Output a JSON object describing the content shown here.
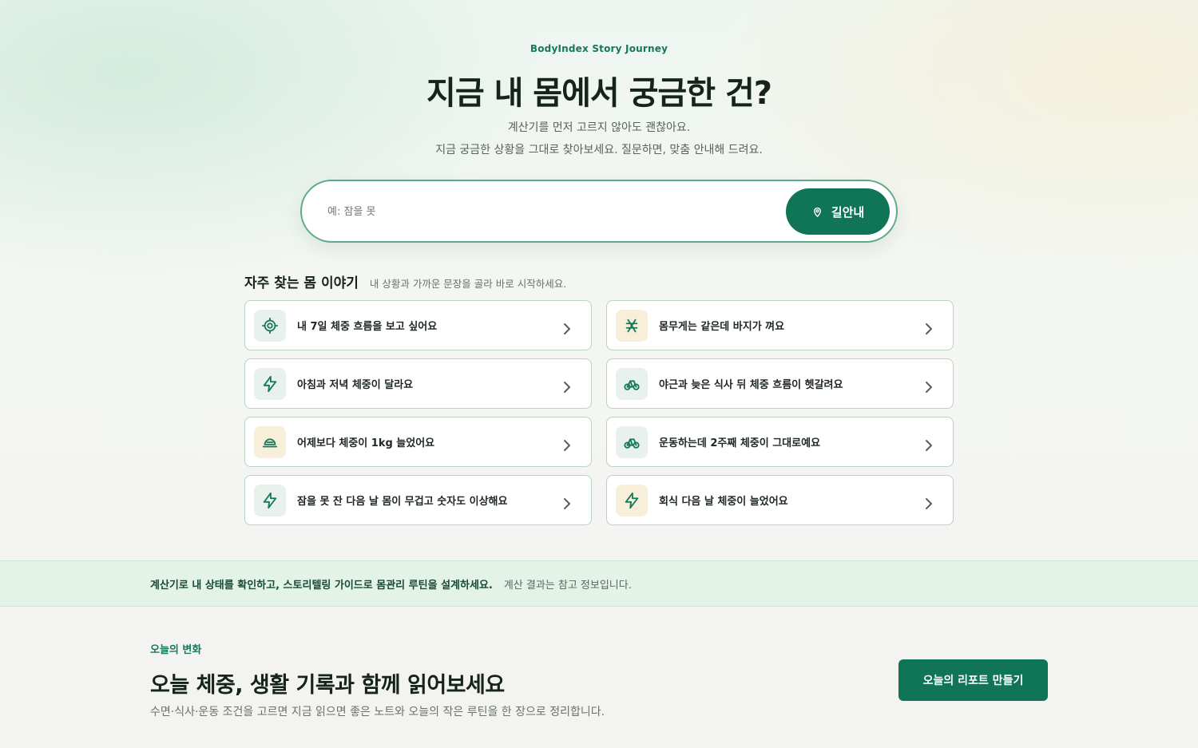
{
  "hero": {
    "eyebrow": "BodyIndex Story Journey",
    "title": "지금 내 몸에서 궁금한 건?",
    "subtitle_line1": "계산기를 먼저 고르지 않아도 괜찮아요.",
    "subtitle_line2": "지금 궁금한 상황을 그대로 찾아보세요. 질문하면, 맞춤 안내해 드려요."
  },
  "search": {
    "placeholder": "예: 잠을 못",
    "button_label": "길안내",
    "button_icon": "map-pin-icon"
  },
  "stories": {
    "title": "자주 찾는 몸 이야기",
    "description": "내 상황과 가까운 문장을 골라 바로 시작하세요.",
    "items": [
      {
        "label": "내 7일 체중 흐름을 보고 싶어요",
        "icon": "target-icon",
        "tone": "green"
      },
      {
        "label": "몸무게는 같은데 바지가 껴요",
        "icon": "scale-icon",
        "tone": "beige"
      },
      {
        "label": "아침과 저녁 체중이 달라요",
        "icon": "lightning-icon",
        "tone": "green"
      },
      {
        "label": "야근과 늦은 식사 뒤 체중 흐름이 헷갈려요",
        "icon": "bicycle-icon",
        "tone": "green"
      },
      {
        "label": "어제보다 체중이 1kg 늘었어요",
        "icon": "meal-cover-icon",
        "tone": "beige"
      },
      {
        "label": "운동하는데 2주째 체중이 그대로예요",
        "icon": "bicycle-icon",
        "tone": "green"
      },
      {
        "label": "잠을 못 잔 다음 날 몸이 무겁고 숫자도 이상해요",
        "icon": "lightning-icon",
        "tone": "green"
      },
      {
        "label": "회식 다음 날 체중이 늘었어요",
        "icon": "lightning-icon",
        "tone": "beige"
      }
    ]
  },
  "banner": {
    "strong": "계산기로 내 상태를 확인하고, 스토리텔링 가이드로 몸관리 루틴을 설계하세요.",
    "note": "계산 결과는 참고 정보입니다."
  },
  "today": {
    "eyebrow": "오늘의 변화",
    "title": "오늘 체중, 생활 기록과 함께 읽어보세요",
    "description": "수면·식사·운동 조건을 고르면 지금 읽으면 좋은 노트와 오늘의 작은 루틴을 한 장으로 정리합니다.",
    "button_label": "오늘의 리포트 만들기"
  },
  "colors": {
    "accent": "#0f7556",
    "accent_text": "#17785a",
    "card_border": "#b6d3c5",
    "icon_bg_green": "#e8f1ec",
    "icon_bg_beige": "#f7efd9",
    "banner_bg": "#e3f3e8"
  }
}
